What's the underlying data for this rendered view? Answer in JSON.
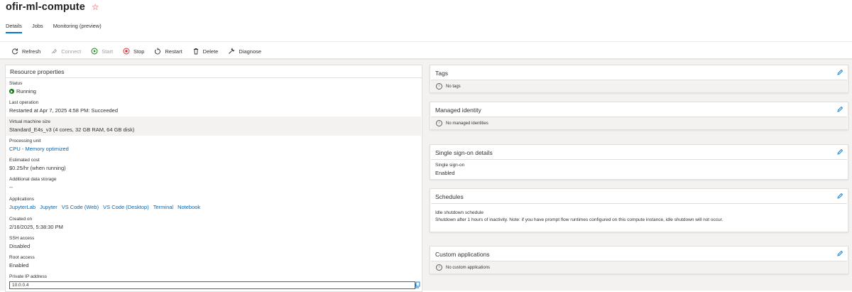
{
  "header": {
    "title": "ofir-ml-compute",
    "favorite_icon": "star-outline-icon"
  },
  "tabs": [
    {
      "label": "Details",
      "active": true
    },
    {
      "label": "Jobs",
      "active": false
    },
    {
      "label": "Monitoring (preview)",
      "active": false
    }
  ],
  "toolbar": {
    "refresh": "Refresh",
    "connect": "Connect",
    "start": "Start",
    "stop": "Stop",
    "restart": "Restart",
    "delete": "Delete",
    "diagnose": "Diagnose"
  },
  "resource_properties": {
    "heading": "Resource properties",
    "status_label": "Status",
    "status_value": "Running",
    "last_op_label": "Last operation",
    "last_op_value": "Restarted at Apr 7, 2025 4:58 PM: Succeeded",
    "vm_size_label": "Virtual machine size",
    "vm_size_value": "Standard_E4s_v3 (4 cores, 32 GB RAM, 64 GB disk)",
    "processing_label": "Processing unit",
    "processing_value": "CPU - Memory optimized",
    "cost_label": "Estimated cost",
    "cost_value": "$0.25/hr (when running)",
    "storage_label": "Additional data storage",
    "storage_value": "--",
    "apps_label": "Applications",
    "apps": [
      "JupyterLab",
      "Jupyter",
      "VS Code (Web)",
      "VS Code (Desktop)",
      "Terminal",
      "Notebook"
    ],
    "created_label": "Created on",
    "created_value": "2/16/2025, 5:38:30 PM",
    "ssh_label": "SSH access",
    "ssh_value": "Disabled",
    "root_label": "Root access",
    "root_value": "Enabled",
    "ip_label": "Private IP address",
    "ip_value": "10.0.0.4"
  },
  "tags": {
    "heading": "Tags",
    "info": "No tags"
  },
  "identity": {
    "heading": "Managed identity",
    "info": "No managed identities"
  },
  "sso": {
    "heading": "Single sign-on details",
    "label": "Single sign-on",
    "value": "Enabled"
  },
  "schedules": {
    "heading": "Schedules",
    "label": "Idle shutdown schedule",
    "value": "Shutdown after 1 hours of inactivity. Note: if you have prompt flow runtimes configured on this compute instance, idle shutdown will not occur."
  },
  "custom_apps": {
    "heading": "Custom applications",
    "info": "No custom applications"
  },
  "colors": {
    "accent": "#0078d4",
    "link": "#0067b8",
    "running": "#107c10",
    "stop": "#d13438"
  }
}
